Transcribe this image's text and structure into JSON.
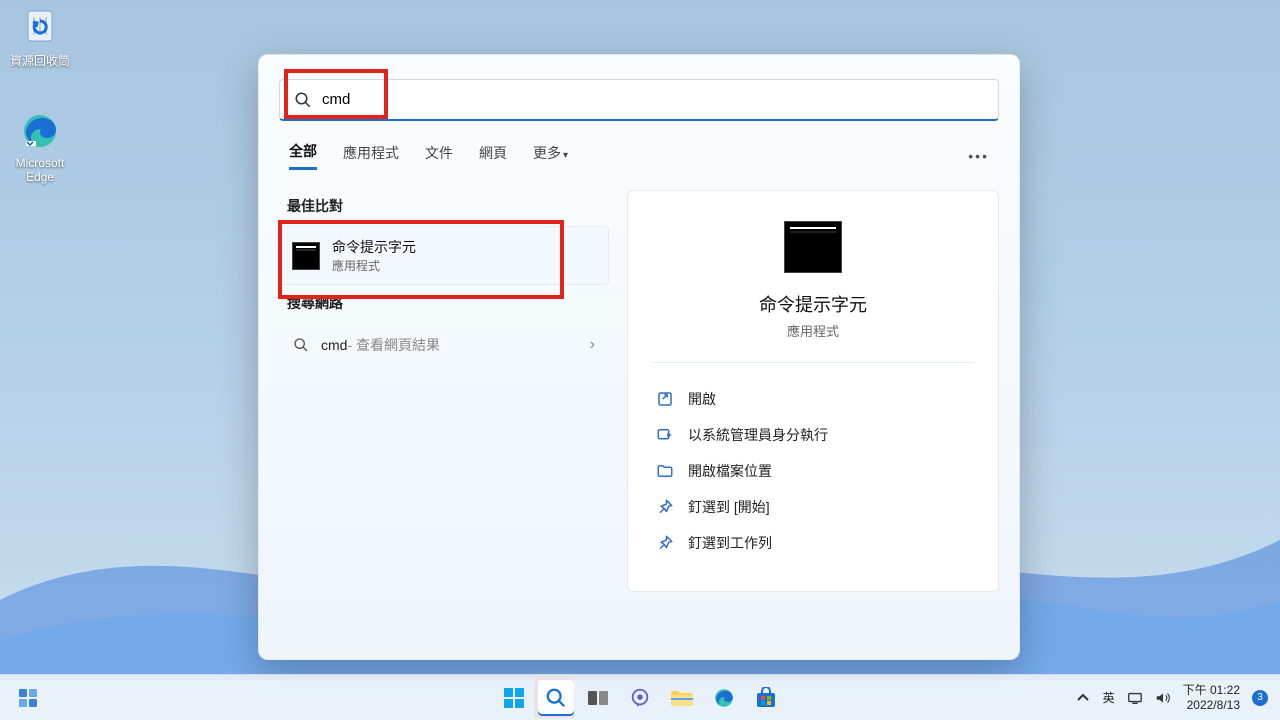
{
  "desktop": {
    "recycle_bin": "資源回收筒",
    "edge": "Microsoft Edge"
  },
  "search": {
    "input_value": "cmd",
    "filters": {
      "all": "全部",
      "apps": "應用程式",
      "documents": "文件",
      "web": "網頁",
      "more": "更多"
    },
    "sections": {
      "best_match": "最佳比對",
      "search_web": "搜尋網路"
    },
    "best_match_result": {
      "title": "命令提示字元",
      "subtitle": "應用程式"
    },
    "web_result": {
      "term": "cmd",
      "suffix": " - 查看網頁結果"
    },
    "preview": {
      "title": "命令提示字元",
      "subtitle": "應用程式",
      "actions": {
        "open": "開啟",
        "run_admin": "以系統管理員身分執行",
        "open_location": "開啟檔案位置",
        "pin_start": "釘選到 [開始]",
        "pin_taskbar": "釘選到工作列"
      }
    }
  },
  "taskbar": {
    "ime": "英",
    "time_label": "下午 01:22",
    "date_label": "2022/8/13",
    "notif_count": "3"
  }
}
